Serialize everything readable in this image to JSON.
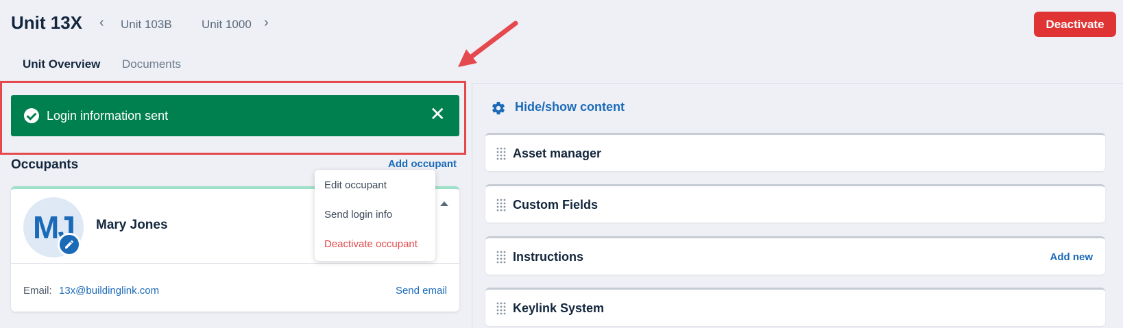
{
  "header": {
    "unit_title": "Unit 13X",
    "prev_unit": "Unit 103B",
    "next_unit": "Unit 1000",
    "deactivate_label": "Deactivate"
  },
  "tabs": [
    {
      "label": "Unit Overview",
      "active": true
    },
    {
      "label": "Documents",
      "active": false
    }
  ],
  "toast": {
    "message": "Login information sent",
    "close_icon": "close-icon",
    "color": "#007f4f"
  },
  "occupants": {
    "title": "Occupants",
    "add_label": "Add occupant",
    "card": {
      "initials": "MJ",
      "name": "Mary Jones",
      "email_label": "Email:",
      "email": "13x@buildinglink.com",
      "send_email_label": "Send email"
    },
    "menu": [
      {
        "label": "Edit occupant"
      },
      {
        "label": "Send login info"
      },
      {
        "label": "Deactivate occupant"
      }
    ]
  },
  "right_panel": {
    "hide_show_label": "Hide/show content",
    "sections": [
      {
        "title": "Asset manager",
        "action": ""
      },
      {
        "title": "Custom Fields",
        "action": ""
      },
      {
        "title": "Instructions",
        "action": "Add new"
      },
      {
        "title": "Keylink System",
        "action": ""
      }
    ]
  },
  "colors": {
    "accent": "#1a6ab8",
    "danger": "#e03434",
    "highlight": "#e5484d"
  }
}
